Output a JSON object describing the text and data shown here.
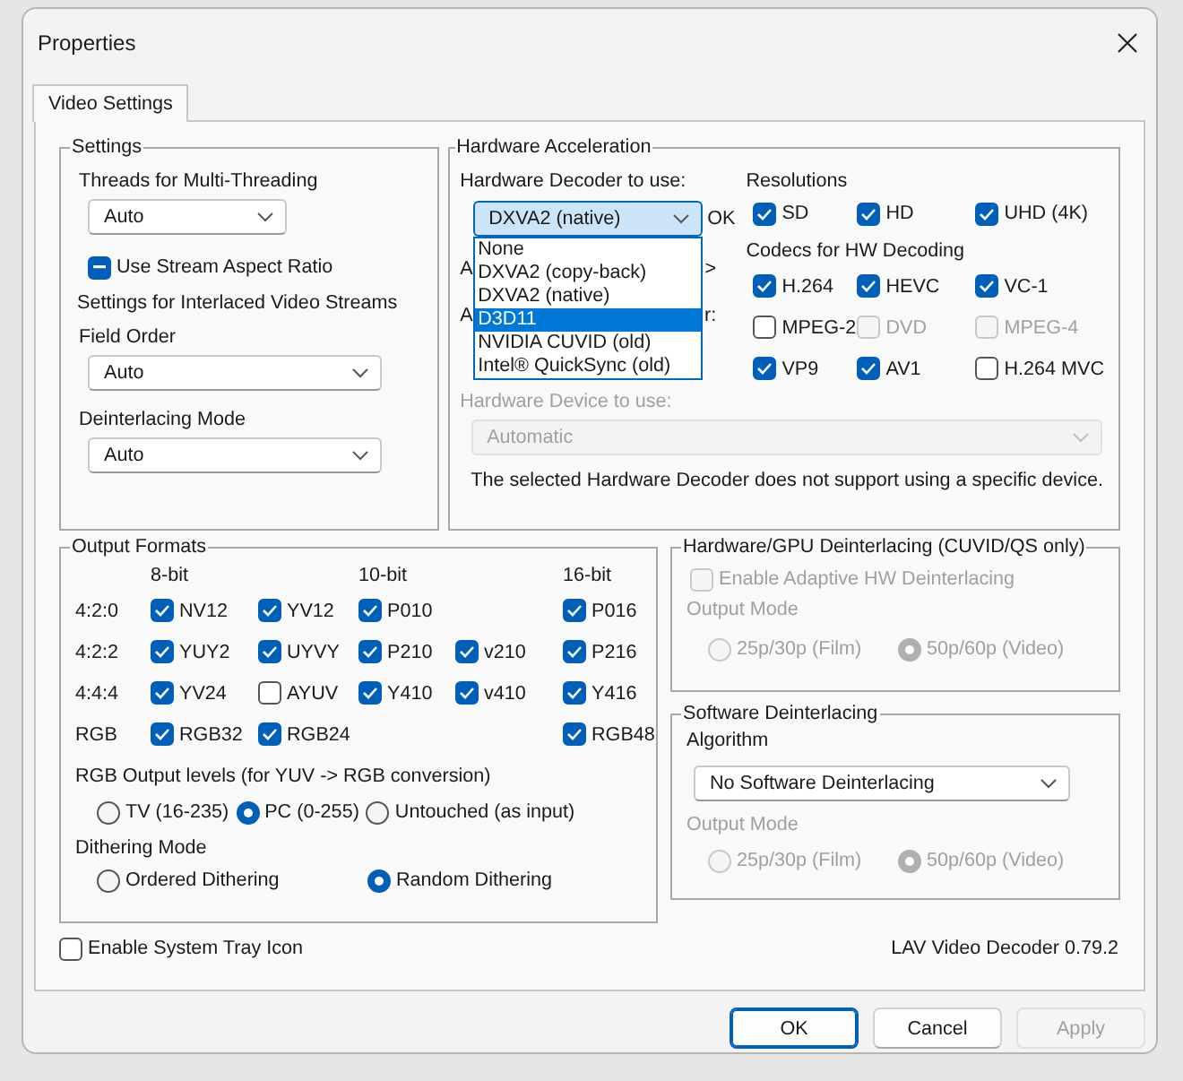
{
  "window": {
    "title": "Properties"
  },
  "tabs": [
    {
      "label": "Video Settings",
      "selected": true
    }
  ],
  "settings": {
    "title": "Settings",
    "threads_label": "Threads for Multi-Threading",
    "threads_value": "Auto",
    "aspect": {
      "label": "Use Stream Aspect Ratio",
      "indeterminate": true
    },
    "interlaced_label": "Settings for Interlaced Video Streams",
    "field_order_label": "Field Order",
    "field_order_value": "Auto",
    "deint_mode_label": "Deinterlacing Mode",
    "deint_mode_value": "Auto"
  },
  "hw_accel": {
    "title": "Hardware Acceleration",
    "decoder_label": "Hardware Decoder to use:",
    "decoder_value": "DXVA2 (native)",
    "decoder_status": "OK",
    "expanded": true,
    "decoder_options": [
      {
        "label": "None",
        "selected": false
      },
      {
        "label": "DXVA2 (copy-back)",
        "selected": false
      },
      {
        "label": "DXVA2 (native)",
        "selected": false
      },
      {
        "label": "D3D11",
        "selected": true
      },
      {
        "label": "NVIDIA CUVID (old)",
        "selected": false
      },
      {
        "label": "Intel® QuickSync (old)",
        "selected": false
      }
    ],
    "covered_rows": [
      {
        "left": "A",
        "right": ">"
      },
      {
        "left": "A",
        "right": "r:"
      }
    ],
    "device_label": "Hardware Device to use:",
    "device_value": "Automatic",
    "device_disabled": true,
    "device_note": "The selected Hardware Decoder does not support using a specific device.",
    "resolutions_title": "Resolutions",
    "resolutions": [
      {
        "label": "SD",
        "checked": true,
        "disabled": false
      },
      {
        "label": "HD",
        "checked": true,
        "disabled": false
      },
      {
        "label": "UHD (4K)",
        "checked": true,
        "disabled": false
      }
    ],
    "codecs_title": "Codecs for HW Decoding",
    "codecs": [
      {
        "label": "H.264",
        "checked": true,
        "disabled": false
      },
      {
        "label": "HEVC",
        "checked": true,
        "disabled": false
      },
      {
        "label": "VC-1",
        "checked": true,
        "disabled": false
      },
      {
        "label": "MPEG-2",
        "checked": false,
        "disabled": false
      },
      {
        "label": "DVD",
        "checked": false,
        "disabled": true
      },
      {
        "label": "MPEG-4",
        "checked": false,
        "disabled": true
      },
      {
        "label": "VP9",
        "checked": true,
        "disabled": false
      },
      {
        "label": "AV1",
        "checked": true,
        "disabled": false
      },
      {
        "label": "H.264 MVC",
        "checked": false,
        "disabled": false
      }
    ]
  },
  "output_formats": {
    "title": "Output Formats",
    "headers": [
      {
        "kind": "header",
        "label": "8-bit"
      },
      {
        "kind": "blank"
      },
      {
        "kind": "header",
        "label": "10-bit"
      },
      {
        "kind": "blank"
      },
      {
        "kind": "header",
        "label": "16-bit"
      }
    ],
    "rows": [
      {
        "label": "4:2:0",
        "formats": [
          {
            "kind": "format",
            "label": "NV12",
            "checked": true
          },
          {
            "kind": "format",
            "label": "YV12",
            "checked": true
          },
          {
            "kind": "format",
            "label": "P010",
            "checked": true
          },
          {
            "kind": "blank"
          },
          {
            "kind": "format",
            "label": "P016",
            "checked": true
          }
        ]
      },
      {
        "label": "4:2:2",
        "formats": [
          {
            "kind": "format",
            "label": "YUY2",
            "checked": true
          },
          {
            "kind": "format",
            "label": "UYVY",
            "checked": true
          },
          {
            "kind": "format",
            "label": "P210",
            "checked": true
          },
          {
            "kind": "format",
            "label": "v210",
            "checked": true
          },
          {
            "kind": "format",
            "label": "P216",
            "checked": true
          }
        ]
      },
      {
        "label": "4:4:4",
        "formats": [
          {
            "kind": "format",
            "label": "YV24",
            "checked": true
          },
          {
            "kind": "format",
            "label": "AYUV",
            "checked": false
          },
          {
            "kind": "format",
            "label": "Y410",
            "checked": true
          },
          {
            "kind": "format",
            "label": "v410",
            "checked": true
          },
          {
            "kind": "format",
            "label": "Y416",
            "checked": true
          }
        ]
      },
      {
        "label": "RGB",
        "formats": [
          {
            "kind": "format",
            "label": "RGB32",
            "checked": true
          },
          {
            "kind": "format",
            "label": "RGB24",
            "checked": true
          },
          {
            "kind": "blank"
          },
          {
            "kind": "blank"
          },
          {
            "kind": "format",
            "label": "RGB48",
            "checked": true
          }
        ]
      }
    ],
    "rgb_levels_label": "RGB Output levels (for YUV -> RGB conversion)",
    "rgb_levels": [
      {
        "label": "TV (16-235)",
        "selected": false
      },
      {
        "label": "PC (0-255)",
        "selected": true
      },
      {
        "label": "Untouched (as input)",
        "selected": false
      }
    ],
    "dithering_label": "Dithering Mode",
    "dithering": [
      {
        "label": "Ordered Dithering",
        "selected": false
      },
      {
        "label": "Random Dithering",
        "selected": true
      }
    ]
  },
  "hw_deint": {
    "title": "Hardware/GPU Deinterlacing (CUVID/QS only)",
    "disabled": true,
    "enable": {
      "label": "Enable Adaptive HW Deinterlacing",
      "checked": false
    },
    "output_mode_label": "Output Mode",
    "modes": [
      {
        "label": "25p/30p (Film)",
        "selected": false
      },
      {
        "label": "50p/60p (Video)",
        "selected": true
      }
    ]
  },
  "sw_deint": {
    "title": "Software Deinterlacing",
    "algorithm_label": "Algorithm",
    "algorithm_value": "No Software Deinterlacing",
    "output_mode_label": "Output Mode",
    "output_disabled": true,
    "modes": [
      {
        "label": "25p/30p (Film)",
        "selected": false
      },
      {
        "label": "50p/60p (Video)",
        "selected": true
      }
    ]
  },
  "tray": {
    "label": "Enable System Tray Icon",
    "checked": false
  },
  "version": "LAV Video Decoder 0.79.2",
  "buttons": [
    {
      "label": "OK",
      "default": true,
      "disabled": false
    },
    {
      "label": "Cancel",
      "default": false,
      "disabled": false
    },
    {
      "label": "Apply",
      "default": false,
      "disabled": true
    }
  ]
}
